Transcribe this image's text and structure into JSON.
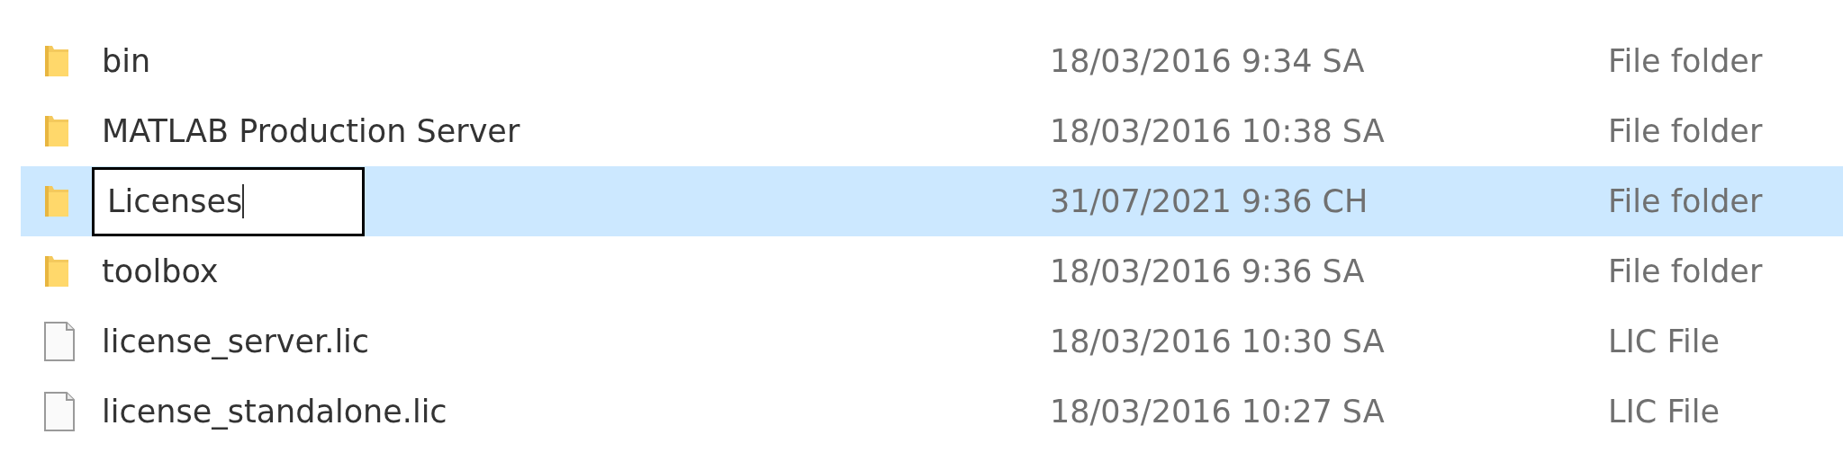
{
  "files": [
    {
      "kind": "folder",
      "name": "bin",
      "date_modified": "18/03/2016 9:34 SA",
      "type": "File folder",
      "selected": false,
      "renaming": false
    },
    {
      "kind": "folder",
      "name": "MATLAB Production Server",
      "date_modified": "18/03/2016 10:38 SA",
      "type": "File folder",
      "selected": false,
      "renaming": false
    },
    {
      "kind": "folder",
      "name": "Licenses",
      "date_modified": "31/07/2021 9:36 CH",
      "type": "File folder",
      "selected": true,
      "renaming": true
    },
    {
      "kind": "folder",
      "name": "toolbox",
      "date_modified": "18/03/2016 9:36 SA",
      "type": "File folder",
      "selected": false,
      "renaming": false
    },
    {
      "kind": "file",
      "name": "license_server.lic",
      "date_modified": "18/03/2016 10:30 SA",
      "type": "LIC File",
      "selected": false,
      "renaming": false
    },
    {
      "kind": "file",
      "name": "license_standalone.lic",
      "date_modified": "18/03/2016 10:27 SA",
      "type": "LIC File",
      "selected": false,
      "renaming": false
    }
  ]
}
